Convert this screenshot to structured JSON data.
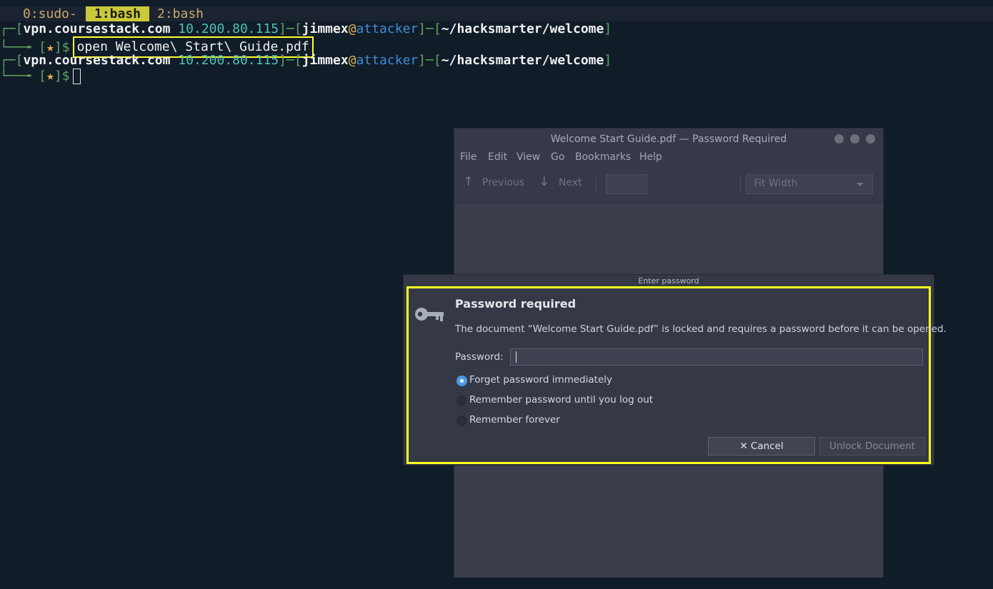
{
  "tmux": {
    "tabs": [
      {
        "label": "0:sudo-"
      },
      {
        "label": "1:bash",
        "active": true
      },
      {
        "label": "2:bash"
      }
    ]
  },
  "terminal": {
    "prompt": {
      "host": "vpn.coursestack.com",
      "ip": "10.200.80.115",
      "user": "jimmex",
      "at": "@",
      "machine": "attacker",
      "path": "~/hacksmarter/welcome",
      "star": "★",
      "dollar": "$"
    },
    "command": "open Welcome\\ Start\\ Guide.pdf"
  },
  "pdf_viewer": {
    "title": "Welcome Start Guide.pdf — Password Required",
    "menu": [
      "File",
      "Edit",
      "View",
      "Go",
      "Bookmarks",
      "Help"
    ],
    "toolbar": {
      "previous": "Previous",
      "next": "Next",
      "zoom": "Fit Width"
    }
  },
  "dialog": {
    "title": "Enter password",
    "heading": "Password required",
    "message": "The document “Welcome Start Guide.pdf” is locked and requires a password before it can be opened.",
    "password_label": "Password:",
    "options": [
      {
        "label": "Forget password immediately",
        "selected": true
      },
      {
        "label": "Remember password until you log out",
        "selected": false
      },
      {
        "label": "Remember forever",
        "selected": false
      }
    ],
    "cancel_label": "✕ Cancel",
    "unlock_label": "Unlock Document"
  },
  "colors": {
    "highlight": "#ffff20",
    "background": "#111c29",
    "accent": "#4d9be6"
  }
}
